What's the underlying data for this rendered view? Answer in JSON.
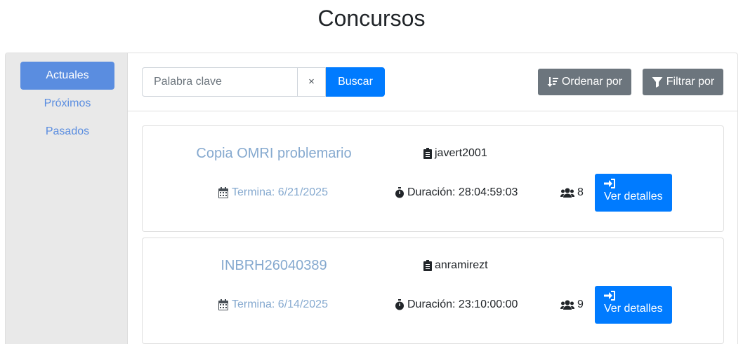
{
  "page": {
    "title": "Concursos"
  },
  "sidebar": {
    "items": [
      {
        "label": "Actuales",
        "active": true
      },
      {
        "label": "Próximos",
        "active": false
      },
      {
        "label": "Pasados",
        "active": false
      }
    ]
  },
  "toolbar": {
    "search_placeholder": "Palabra clave",
    "search_value": "",
    "clear_label": "×",
    "search_label": "Buscar",
    "sort_label": "Ordenar por",
    "filter_label": "Filtrar por"
  },
  "contests": [
    {
      "title": "Copia OMRI problemario",
      "owner": "javert2001",
      "ends": "Termina: 6/21/2025",
      "duration": "Duración: 28:04:59:03",
      "participants": "8",
      "details_label": "Ver detalles"
    },
    {
      "title": "INBRH26040389",
      "owner": "anramirezt",
      "ends": "Termina: 6/14/2025",
      "duration": "Duración: 23:10:00:00",
      "participants": "9",
      "details_label": "Ver detalles"
    }
  ],
  "colors": {
    "primary": "#007bff",
    "sidebar_active": "#5a8de0",
    "secondary_button": "#6c757d",
    "muted_link": "#85a9cf"
  },
  "icons": {
    "sort": "sort-amount-down-icon",
    "filter": "filter-icon",
    "owner": "clipboard-icon",
    "ends": "calendar-icon",
    "duration": "stopwatch-icon",
    "participants": "users-icon",
    "details": "sign-in-icon"
  }
}
